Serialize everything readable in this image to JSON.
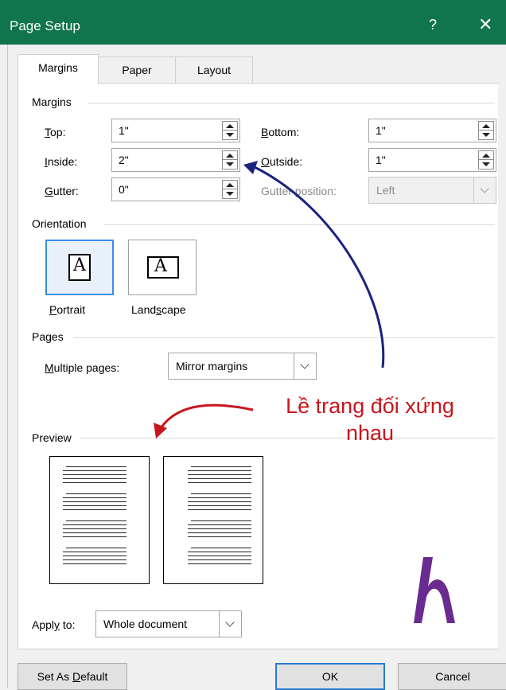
{
  "window": {
    "title": "Page Setup",
    "help_glyph": "?",
    "close_glyph": "✕"
  },
  "tabs": [
    "Margins",
    "Paper",
    "Layout"
  ],
  "margins_section": {
    "title": "Margins",
    "top": {
      "label_key": "T",
      "label_rest": "op:",
      "value": "1\""
    },
    "bottom": {
      "label_key": "B",
      "label_rest": "ottom:",
      "value": "1\""
    },
    "inside": {
      "label_key": "I",
      "label_rest": "nside:",
      "value": "2\""
    },
    "outside": {
      "label_key": "O",
      "label_rest": "utside:",
      "value": "1\""
    },
    "gutter": {
      "label_key": "G",
      "label_rest": "utter:",
      "value": "0\""
    },
    "gutter_position": {
      "label": "Gutter position:",
      "value": "Left"
    }
  },
  "orientation": {
    "title": "Orientation",
    "portrait": {
      "label_key": "P",
      "label_rest": "ortrait",
      "glyph": "A"
    },
    "landscape": {
      "label_pre": "Land",
      "label_key": "s",
      "label_rest": "cape",
      "glyph": "A"
    }
  },
  "pages": {
    "title": "Pages",
    "multiple_pages_key": "M",
    "multiple_pages_rest": "ultiple pages:",
    "value": "Mirror margins"
  },
  "annotation": {
    "line1": "Lề trang đối xứng",
    "line2": "nhau",
    "color": "#c8161d",
    "arrow_color": "#1a237e"
  },
  "preview": {
    "title": "Preview"
  },
  "apply_to": {
    "label_pre": "Appl",
    "label_key": "y",
    "label_rest": " to:",
    "value": "Whole document"
  },
  "buttons": {
    "set_default_pre": "Set As ",
    "set_default_key": "D",
    "set_default_rest": "efault",
    "ok": "OK",
    "cancel": "Cancel"
  },
  "colors": {
    "titlebar": "#10754a",
    "logo": "#6a2b90"
  },
  "logo_icon": "h-logo-icon"
}
